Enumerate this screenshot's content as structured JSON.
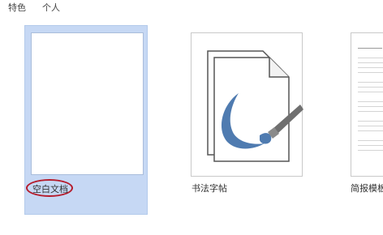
{
  "tabs": [
    {
      "label": "特色"
    },
    {
      "label": "个人"
    }
  ],
  "templates": [
    {
      "label": "空白文档",
      "selected": true
    },
    {
      "label": "书法字帖",
      "selected": false
    },
    {
      "label": "简报模板",
      "selected": false
    }
  ],
  "colors": {
    "selection": "#c6d8f4",
    "highlight_ring": "#b51c2c",
    "brush_stroke": "#4f7bb0"
  }
}
